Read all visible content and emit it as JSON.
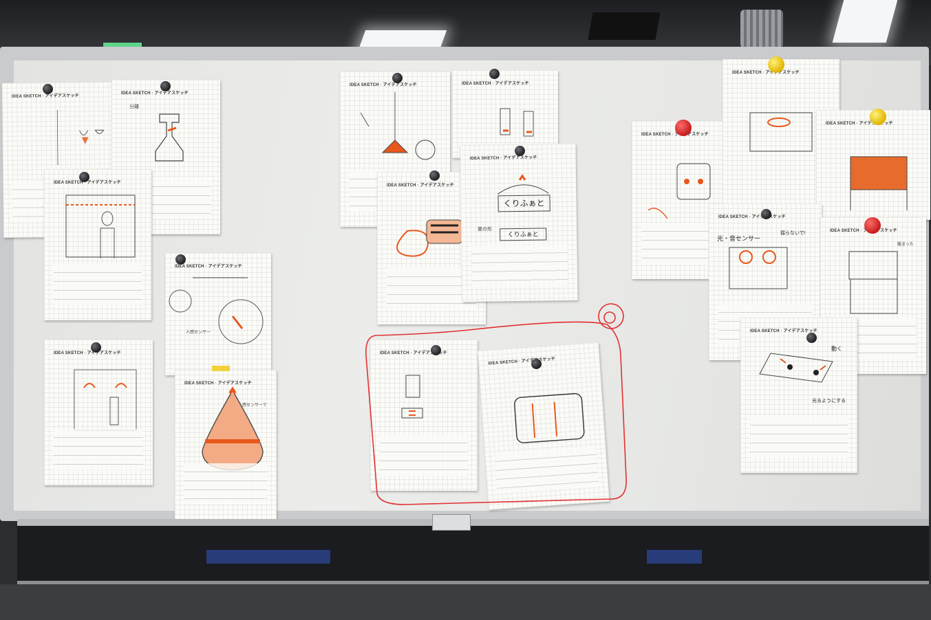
{
  "scene": "whiteboard-with-idea-sketches",
  "sheet_header": "IDEA SKETCH · アイデアスケッチ",
  "annotations": {
    "left_notes": [
      "分離",
      "人感センサー",
      "人感センサーで"
    ],
    "kuri": [
      "くりふぁと",
      "くりふぁと"
    ],
    "kuri_label": "栗の形",
    "sensor_title": "光・音センサー",
    "sensor_note": "揺らないで!",
    "move_note": "動く",
    "light_note": "光るようにする",
    "heat_note": "暖まった"
  },
  "colors": {
    "marker_orange": "#e8581c",
    "marker_red": "#e03030",
    "pencil": "#555555"
  }
}
